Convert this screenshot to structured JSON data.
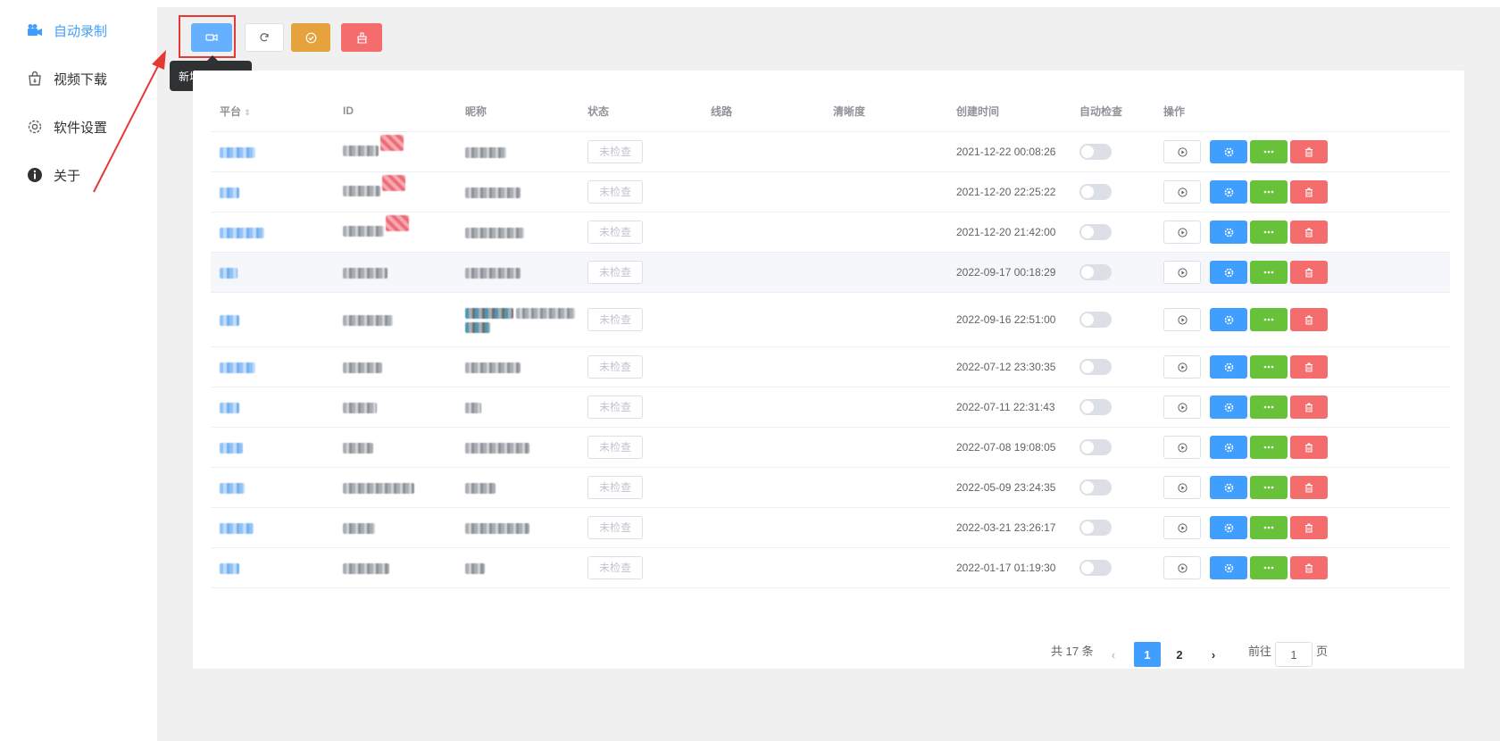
{
  "sidebar": {
    "items": [
      {
        "label": "自动录制",
        "icon": "camera-icon",
        "active": true
      },
      {
        "label": "视频下载",
        "icon": "download-bag-icon",
        "active": false
      },
      {
        "label": "软件设置",
        "icon": "gear-icon",
        "active": false
      },
      {
        "label": "关于",
        "icon": "info-icon",
        "active": false
      }
    ]
  },
  "toolbar": {
    "tooltip": "新增录制任务",
    "buttons": [
      {
        "name": "add-task",
        "icon": "video-camera-icon",
        "color": "#66b1ff"
      },
      {
        "name": "refresh",
        "icon": "refresh-icon",
        "color": "#ffffff"
      },
      {
        "name": "check",
        "icon": "check-circle-icon",
        "color": "#e6a23c"
      },
      {
        "name": "clear",
        "icon": "broom-icon",
        "color": "#f56c6c"
      }
    ]
  },
  "table": {
    "headers": [
      "平台",
      "ID",
      "昵称",
      "状态",
      "线路",
      "清晰度",
      "创建时间",
      "自动检查",
      "操作"
    ],
    "status_label": "未检查",
    "rows": [
      {
        "created": "2021-12-22 00:08:26"
      },
      {
        "created": "2021-12-20 22:25:22"
      },
      {
        "created": "2021-12-20 21:42:00"
      },
      {
        "created": "2022-09-17 00:18:29"
      },
      {
        "created": "2022-09-16 22:51:00"
      },
      {
        "created": "2022-07-12 23:30:35"
      },
      {
        "created": "2022-07-11 22:31:43"
      },
      {
        "created": "2022-07-08 19:08:05"
      },
      {
        "created": "2022-05-09 23:24:35"
      },
      {
        "created": "2022-03-21 23:26:17"
      },
      {
        "created": "2022-01-17 01:19:30"
      }
    ]
  },
  "pagination": {
    "total_text": "共 17 条",
    "pages": [
      "1",
      "2"
    ],
    "current": "1",
    "goto_label": "前往",
    "goto_value": "1",
    "page_suffix": "页"
  },
  "colors": {
    "primary": "#409eff",
    "success": "#67c23a",
    "warning": "#e6a23c",
    "danger": "#f56c6c",
    "annotation": "#e53935"
  }
}
